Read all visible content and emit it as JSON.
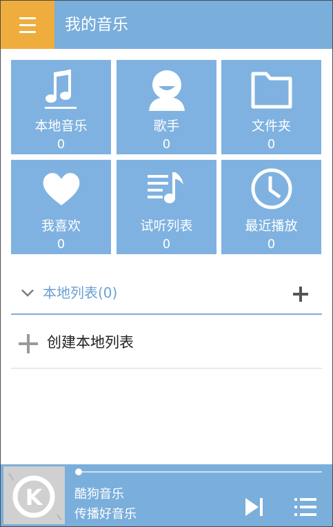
{
  "header": {
    "title": "我的音乐",
    "menu_icon": "menu-icon"
  },
  "tiles": [
    {
      "label": "本地音乐",
      "count": "0",
      "icon": "music-note-icon"
    },
    {
      "label": "歌手",
      "count": "0",
      "icon": "singer-icon"
    },
    {
      "label": "文件夹",
      "count": "0",
      "icon": "folder-icon"
    },
    {
      "label": "我喜欢",
      "count": "0",
      "icon": "heart-icon"
    },
    {
      "label": "试听列表",
      "count": "0",
      "icon": "playlist-icon"
    },
    {
      "label": "最近播放",
      "count": "0",
      "icon": "clock-icon"
    }
  ],
  "local_list": {
    "title": "本地列表(0)",
    "create_label": "创建本地列表"
  },
  "player": {
    "song": "酷狗音乐",
    "artist": "传播好音乐",
    "progress": 0
  },
  "colors": {
    "accent": "#7aaedb",
    "tile": "#7fb2e0",
    "menu": "#efad3d"
  }
}
